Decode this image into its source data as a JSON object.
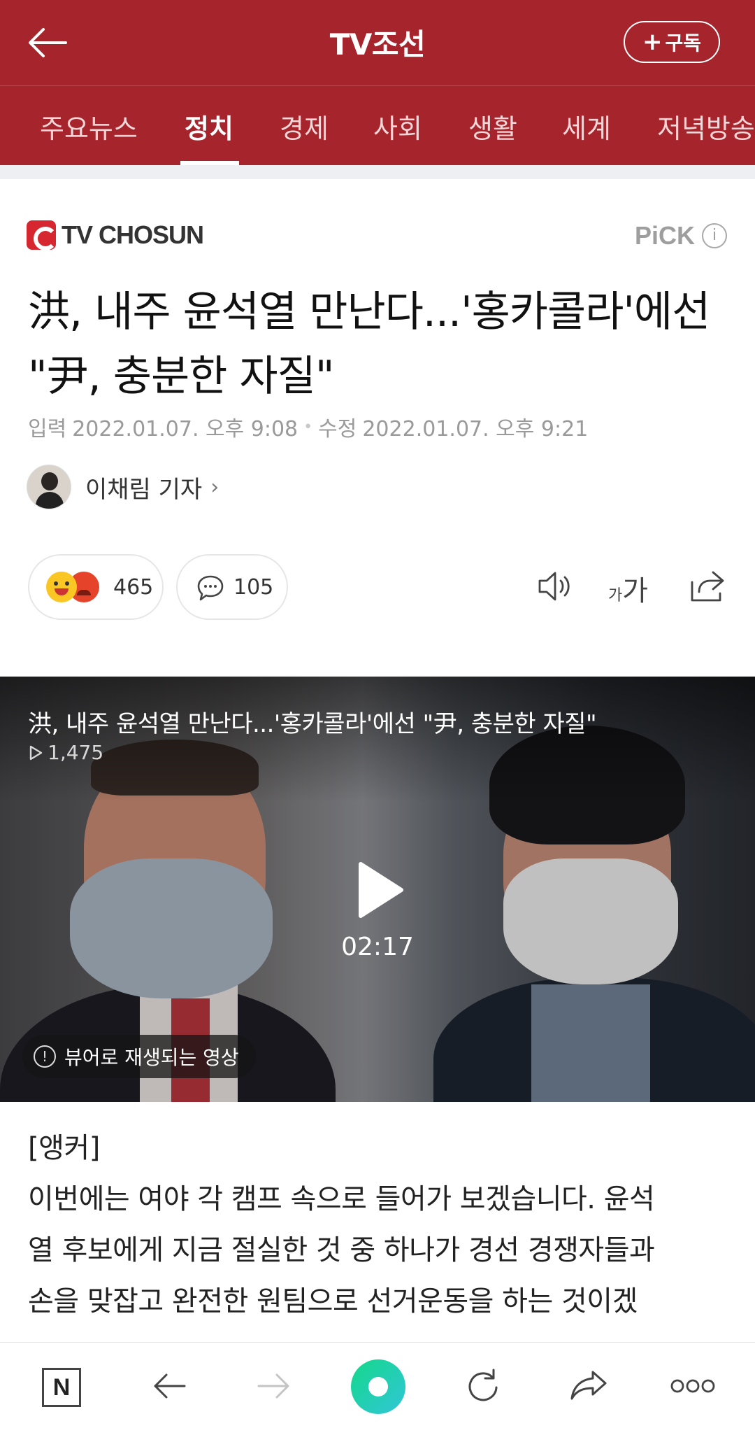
{
  "header": {
    "title": "TV조선",
    "subscribe_label": "구독"
  },
  "tabs": [
    {
      "label": "주요뉴스",
      "active": false
    },
    {
      "label": "정치",
      "active": true
    },
    {
      "label": "경제",
      "active": false
    },
    {
      "label": "사회",
      "active": false
    },
    {
      "label": "생활",
      "active": false
    },
    {
      "label": "세계",
      "active": false
    },
    {
      "label": "저녁방송",
      "active": false
    }
  ],
  "article": {
    "press": "TV CHOSUN",
    "pick_label": "PiCK",
    "headline": "洪, 내주 윤석열 만난다...'홍카콜라'에선 \"尹, 충분한 자질\"",
    "input_label": "입력",
    "input_time": "2022.01.07. 오후 9:08",
    "modified_label": "수정",
    "modified_time": "2022.01.07. 오후 9:21",
    "reporter": "이채림 기자",
    "reaction_count": "465",
    "comment_count": "105"
  },
  "video": {
    "title": "洪, 내주 윤석열 만난다...'홍카콜라'에선 \"尹, 충분한 자질\"",
    "views": "1,475",
    "duration": "02:17",
    "notice": "뷰어로 재생되는 영상"
  },
  "body": {
    "section_label": "[앵커]",
    "lines": [
      "이번에는 여야 각 캠프 속으로 들어가 보겠습니다. 윤석",
      "열 후보에게 지금 절실한 것 중 하나가 경선 경쟁자들과",
      "손을 맞잡고 완전한 원팀으로 선거운동을 하는 것이겠"
    ]
  },
  "bottom_nav": {
    "naver_label": "N"
  },
  "colors": {
    "brand": "#a6242c",
    "accent_green": "#14d88a"
  },
  "icons": [
    "back-arrow-icon",
    "plus-icon",
    "info-icon",
    "speaker-icon",
    "font-size-icon",
    "share-icon",
    "play-icon",
    "comment-icon",
    "forward-icon",
    "refresh-icon",
    "more-icon"
  ]
}
